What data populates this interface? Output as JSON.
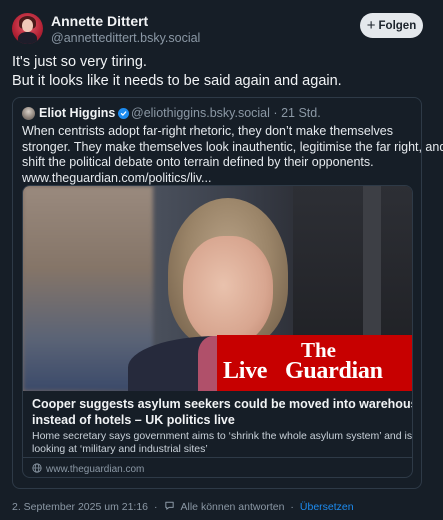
{
  "author": {
    "display_name": "Annette Dittert",
    "handle": "@annettedittert.bsky.social"
  },
  "follow_button": {
    "label": "Folgen"
  },
  "post": {
    "lines": [
      "It's just so very tiring.",
      "But it looks like it needs to be said again and again."
    ]
  },
  "quote": {
    "display_name": "Eliot Higgins",
    "handle": "@eliothiggins.bsky.social",
    "time": "21 Std.",
    "text_lines": [
      "When centrists adopt far-right rhetoric, they don’t make themselves",
      "stronger. They make themselves look inauthentic, legitimise the far right, and",
      "shift the political debate onto terrain defined by their opponents.",
      "www.theguardian.com/politics/liv..."
    ],
    "link_card": {
      "logo_the": "The",
      "logo_live": "Live",
      "logo_guardian": "Guardian",
      "title_lines": [
        "Cooper suggests asylum seekers could be moved into warehouses",
        "instead of hotels – UK politics live"
      ],
      "description_lines": [
        "Home secretary says government aims to ‘shrink the whole asylum system’ and is",
        "looking at ‘military and industrial sites’"
      ],
      "domain": "www.theguardian.com"
    }
  },
  "footer": {
    "date": "2. September 2025 um 21:16",
    "reply_setting": "Alle können antworten",
    "translate": "Übersetzen",
    "separator": "·"
  },
  "colors": {
    "background": "#161e27",
    "accent": "#1d8cf0",
    "guardian_red": "#c70000"
  }
}
